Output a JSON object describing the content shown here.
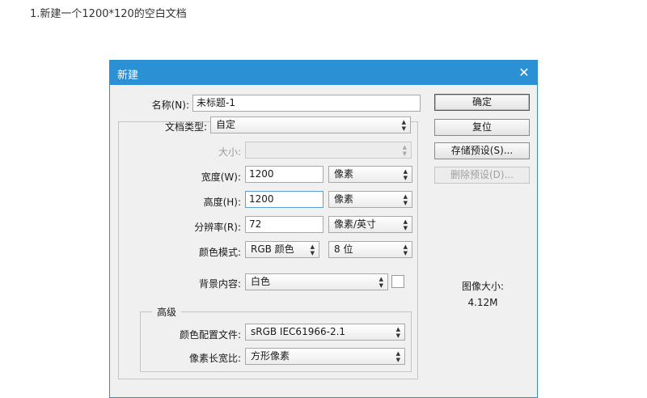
{
  "caption": "1.新建一个1200*120的空白文档",
  "dialog": {
    "title": "新建",
    "close_glyph": "✕",
    "name": {
      "label": "名称(N):",
      "value": "未标题-1"
    },
    "doc_type": {
      "label": "文档类型:",
      "value": "自定"
    },
    "size": {
      "label": "大小:",
      "value": ""
    },
    "width": {
      "label": "宽度(W):",
      "value": "1200",
      "unit": "像素"
    },
    "height": {
      "label": "高度(H):",
      "value": "1200",
      "unit": "像素"
    },
    "resolution": {
      "label": "分辨率(R):",
      "value": "72",
      "unit": "像素/英寸"
    },
    "color_mode": {
      "label": "颜色模式:",
      "value": "RGB 颜色",
      "bits": "8 位"
    },
    "background": {
      "label": "背景内容:",
      "value": "白色"
    },
    "advanced": {
      "label": "高级",
      "color_profile": {
        "label": "颜色配置文件:",
        "value": "sRGB IEC61966-2.1"
      },
      "pixel_aspect": {
        "label": "像素长宽比:",
        "value": "方形像素"
      }
    },
    "buttons": {
      "ok": "确定",
      "reset": "复位",
      "save_preset": "存储预设(S)...",
      "delete_preset": "删除预设(D)..."
    },
    "image_size": {
      "label": "图像大小:",
      "value": "4.12M"
    }
  }
}
